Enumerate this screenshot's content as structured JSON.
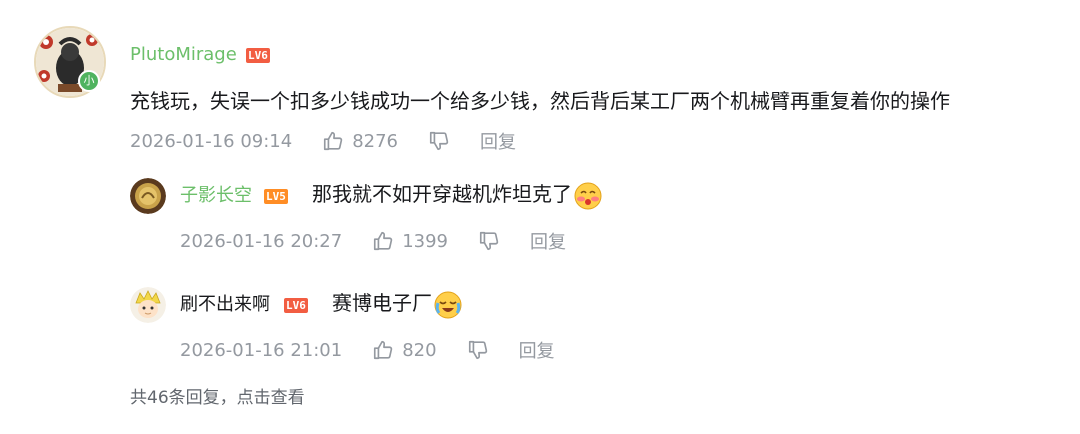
{
  "main_comment": {
    "username": "PlutoMirage",
    "level": "LV6",
    "content": "充钱玩，失误一个扣多少钱成功一个给多少钱，然后背后某工厂两个机械臂再重复着你的操作",
    "time": "2026-01-16 09:14",
    "likes": "8276",
    "reply_label": "回复",
    "avatar_badge": "小"
  },
  "replies": [
    {
      "username": "子影长空",
      "level": "LV5",
      "content": "那我就不如开穿越机炸坦克了",
      "emoji_icon": "blush-emoji-icon",
      "time": "2026-01-16 20:27",
      "likes": "1399",
      "reply_label": "回复"
    },
    {
      "username": "刷不出来啊",
      "level": "LV6",
      "content": "赛博电子厂",
      "emoji_icon": "crying-laugh-emoji-icon",
      "time": "2026-01-16 21:01",
      "likes": "820",
      "reply_label": "回复"
    }
  ],
  "more_replies": "共46条回复，点击查看",
  "colors": {
    "username_green": "#6cbf6a",
    "meta_gray": "#9499a0",
    "lv6": "#f25d42",
    "lv5": "#ff8d25"
  }
}
